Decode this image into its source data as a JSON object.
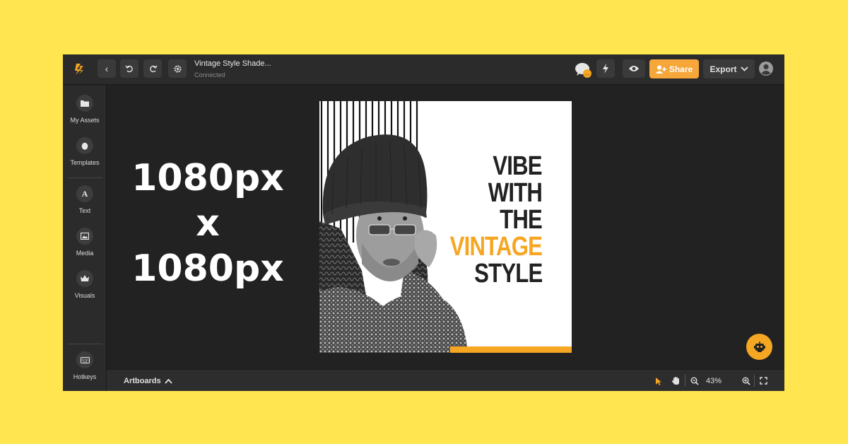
{
  "header": {
    "document_title": "Vintage Style Shade...",
    "status": "Connected",
    "share_label": "Share",
    "export_label": "Export",
    "icons": [
      "logo-icon",
      "back-icon",
      "undo-icon",
      "redo-icon",
      "settings-icon",
      "comments-icon",
      "lightning-icon",
      "preview-icon",
      "add-user-icon",
      "chevron-down-icon",
      "user-avatar-icon"
    ]
  },
  "sidebar": {
    "items": [
      {
        "label": "My Assets",
        "icon": "folder-icon"
      },
      {
        "label": "Templates",
        "icon": "egg-icon"
      },
      {
        "label": "Text",
        "icon": "text-icon"
      },
      {
        "label": "Media",
        "icon": "image-icon"
      },
      {
        "label": "Visuals",
        "icon": "crown-icon"
      },
      {
        "label": "Hotkeys",
        "icon": "keyboard-icon"
      }
    ]
  },
  "canvas": {
    "size_overlay": [
      "1080px",
      "x",
      "1080px"
    ],
    "poster_lines": [
      {
        "text": "VIBE",
        "color": "#222222"
      },
      {
        "text": "WITH",
        "color": "#222222"
      },
      {
        "text": "THE",
        "color": "#222222"
      },
      {
        "text": "VINTAGE",
        "color": "#F5A623"
      },
      {
        "text": "STYLE",
        "color": "#222222"
      }
    ]
  },
  "footer": {
    "artboards_label": "Artboards",
    "zoom_level": "43%"
  },
  "colors": {
    "accent": "#F7A63A",
    "background": "#FFE54F",
    "app_bg": "#222222"
  }
}
